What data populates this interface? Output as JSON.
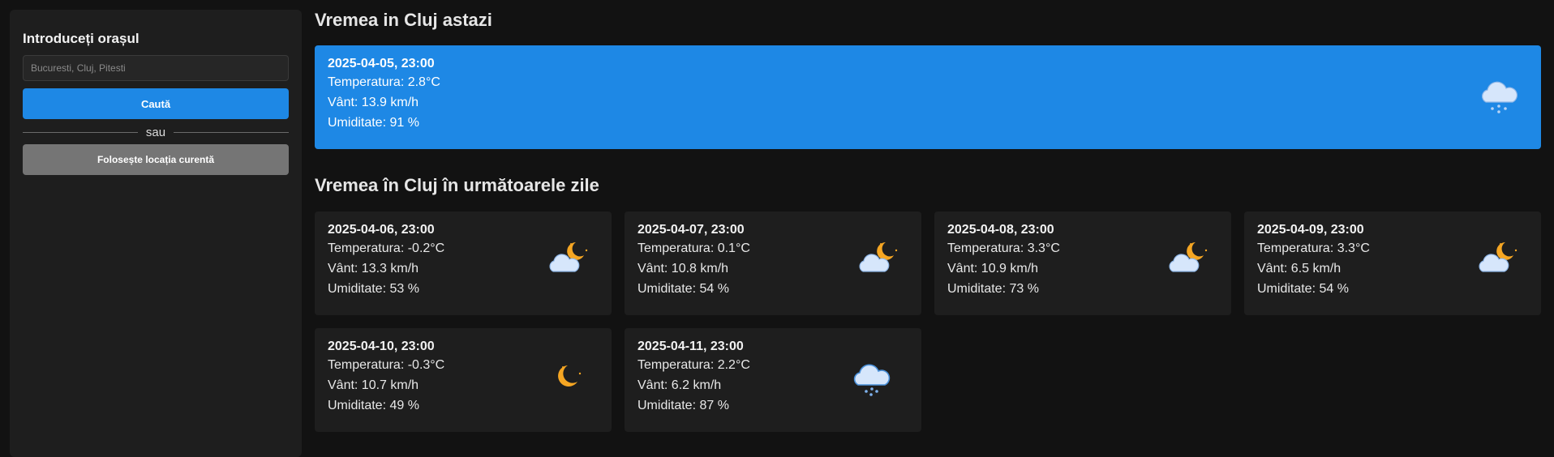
{
  "sidebar": {
    "title": "Introduceți orașul",
    "search_placeholder": "Bucuresti, Cluj, Pitesti",
    "search_button": "Caută",
    "divider_text": "sau",
    "location_button": "Folosește locația curentă"
  },
  "today": {
    "heading": "Vremea in Cluj astazi",
    "date": "2025-04-05, 23:00",
    "temperature": "Temperatura: 2.8°C",
    "wind": "Vânt: 13.9 km/h",
    "humidity": "Umiditate: 91 %",
    "icon": "snow-cloud-icon"
  },
  "forecast": {
    "heading": "Vremea în Cluj în următoarele zile",
    "days": [
      {
        "date": "2025-04-06, 23:00",
        "temperature": "Temperatura: -0.2°C",
        "wind": "Vânt: 13.3 km/h",
        "humidity": "Umiditate: 53 %",
        "icon": "cloud-moon-icon"
      },
      {
        "date": "2025-04-07, 23:00",
        "temperature": "Temperatura: 0.1°C",
        "wind": "Vânt: 10.8 km/h",
        "humidity": "Umiditate: 54 %",
        "icon": "cloud-moon-icon"
      },
      {
        "date": "2025-04-08, 23:00",
        "temperature": "Temperatura: 3.3°C",
        "wind": "Vânt: 10.9 km/h",
        "humidity": "Umiditate: 73 %",
        "icon": "cloud-moon-icon"
      },
      {
        "date": "2025-04-09, 23:00",
        "temperature": "Temperatura: 3.3°C",
        "wind": "Vânt: 6.5 km/h",
        "humidity": "Umiditate: 54 %",
        "icon": "cloud-moon-icon"
      },
      {
        "date": "2025-04-10, 23:00",
        "temperature": "Temperatura: -0.3°C",
        "wind": "Vânt: 10.7 km/h",
        "humidity": "Umiditate: 49 %",
        "icon": "moon-icon"
      },
      {
        "date": "2025-04-11, 23:00",
        "temperature": "Temperatura: 2.2°C",
        "wind": "Vânt: 6.2 km/h",
        "humidity": "Umiditate: 87 %",
        "icon": "snow-cloud-icon"
      }
    ]
  },
  "colors": {
    "background": "#121212",
    "panel": "#1e1e1e",
    "accent": "#1e88e5",
    "secondary_button": "#757575",
    "moon": "#f5a623",
    "cloud": "#d6e6fb"
  }
}
